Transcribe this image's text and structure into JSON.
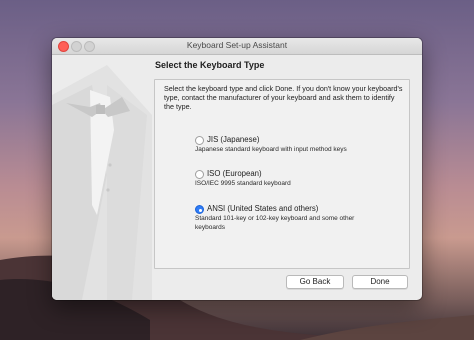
{
  "window": {
    "title": "Keyboard Set-up Assistant"
  },
  "page": {
    "heading": "Select the Keyboard Type",
    "instructions": "Select the keyboard type and click Done. If you don't know your keyboard's type, contact the manufacturer of your keyboard and ask them to identify the type."
  },
  "options": [
    {
      "label": "JIS (Japanese)",
      "description": "Japanese standard keyboard with input method keys",
      "selected": false
    },
    {
      "label": "ISO (European)",
      "description": "ISO/IEC 9995 standard keyboard",
      "selected": false
    },
    {
      "label": "ANSI (United States and others)",
      "description": "Standard 101-key or 102-key keyboard and some other keyboards",
      "selected": true
    }
  ],
  "buttons": {
    "back": "Go Back",
    "done": "Done"
  },
  "colors": {
    "accent": "#2f7cf6",
    "close": "#ff5f57"
  }
}
